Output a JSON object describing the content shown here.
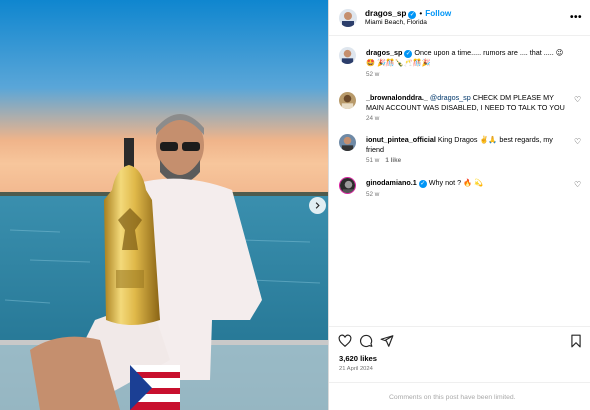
{
  "post": {
    "username": "dragos_sp",
    "follow_label": "Follow",
    "location": "Miami Beach, Florida",
    "separator": "•"
  },
  "caption": {
    "username": "dragos_sp",
    "text": "Once upon a time..... rumors are .... that ..... 😉🤩 🎉🎊🍾🥂🎊🎉",
    "time": "52 w"
  },
  "comments": [
    {
      "username": "_brownalonddra._",
      "mention": "@dragos_sp",
      "text": "CHECK DM PLEASE MY MAIN ACCOUNT WAS DISABLED, I NEED TO TALK TO YOU",
      "time": "24 w",
      "likes": ""
    },
    {
      "username": "ionut_pintea_official",
      "mention": "",
      "text": "King Dragos ✌️🙏 best regards, my friend",
      "time": "51 w",
      "likes": "1 like"
    },
    {
      "username": "ginodamiano.1",
      "mention": "",
      "text": "Why not ? 🔥 💫",
      "time": "52 w",
      "likes": ""
    }
  ],
  "stats": {
    "likes": "3,620 likes",
    "date": "21 April 2024"
  },
  "footer": {
    "notice": "Comments on this post have been limited."
  },
  "icons": {
    "more": "more-options-icon",
    "heart": "heart-icon",
    "comment": "comment-icon",
    "share": "share-icon",
    "save": "bookmark-icon",
    "next": "chevron-right-icon",
    "verified": "verified-badge-icon"
  },
  "colors": {
    "accent": "#0095f6",
    "secondary_text": "#737373",
    "divider": "#dbdbdb"
  }
}
